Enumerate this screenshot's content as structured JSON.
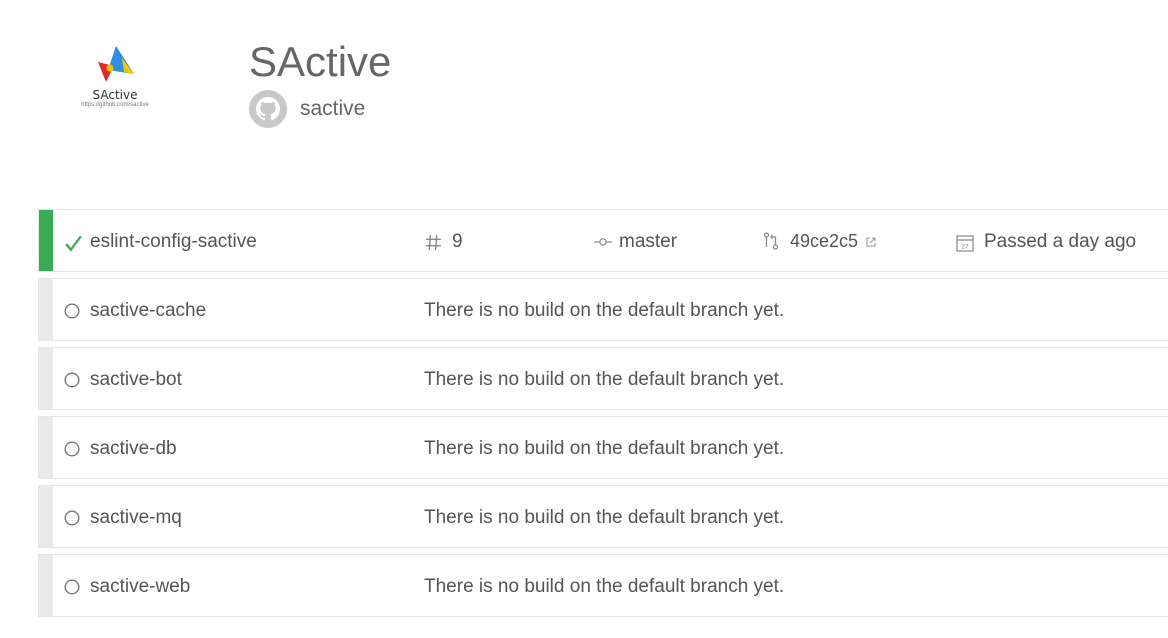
{
  "header": {
    "logo_text": "SActive",
    "logo_url": "https://github.com/sactive",
    "title": "SActive",
    "github_username": "sactive"
  },
  "repos": [
    {
      "name": "eslint-config-sactive",
      "status": "passed",
      "build_number": "9",
      "branch": "master",
      "commit": "49ce2c5",
      "result_text": "Passed a day ago",
      "calendar_day": "27"
    },
    {
      "name": "sactive-cache",
      "status": "none",
      "message": "There is no build on the default branch yet."
    },
    {
      "name": "sactive-bot",
      "status": "none",
      "message": "There is no build on the default branch yet."
    },
    {
      "name": "sactive-db",
      "status": "none",
      "message": "There is no build on the default branch yet."
    },
    {
      "name": "sactive-mq",
      "status": "none",
      "message": "There is no build on the default branch yet."
    },
    {
      "name": "sactive-web",
      "status": "none",
      "message": "There is no build on the default branch yet."
    }
  ],
  "colors": {
    "passed": "#39aa56",
    "neutral": "#eaeaea",
    "text": "#555555"
  }
}
